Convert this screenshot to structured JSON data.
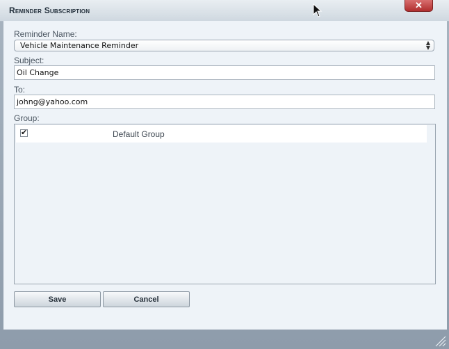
{
  "dialog": {
    "title": "Reminder Subscription",
    "close_label": "✕"
  },
  "form": {
    "reminder_name_label": "Reminder Name:",
    "reminder_name_value": "Vehicle Maintenance Reminder",
    "subject_label": "Subject:",
    "subject_value": "Oil Change",
    "to_label": "To:",
    "to_value": "johng@yahoo.com",
    "group_label": "Group:",
    "groups": [
      {
        "name": "Default Group",
        "checked": true
      }
    ]
  },
  "buttons": {
    "save_label": "Save",
    "cancel_label": "Cancel"
  },
  "icons": {
    "checkbox_mark": "✔",
    "select_arrows": "▲▼"
  }
}
